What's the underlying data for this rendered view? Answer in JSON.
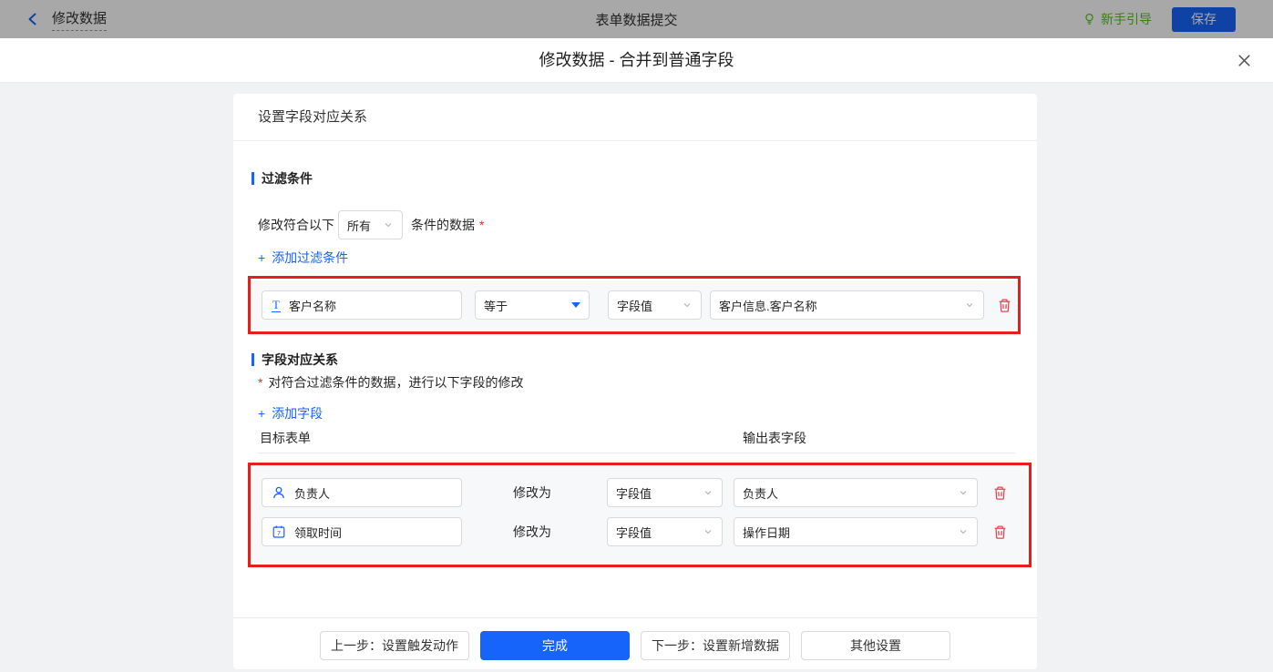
{
  "topbar": {
    "back_label": "修改数据",
    "center_title": "表单数据提交",
    "guide_label": "新手引导",
    "save_label": "保存"
  },
  "modal": {
    "title": "修改数据 - 合并到普通字段"
  },
  "panel": {
    "header_title": "设置字段对应关系",
    "filter": {
      "section_title": "过滤条件",
      "match_prefix": "修改符合以下",
      "match_value": "所有",
      "match_suffix": "条件的数据",
      "required_mark": "*",
      "add_label": "添加过滤条件",
      "row": {
        "field": "客户名称",
        "operator": "等于",
        "value_type": "字段值",
        "value": "客户信息.客户名称"
      }
    },
    "mapping": {
      "section_title": "字段对应关系",
      "required_mark": "*",
      "description": "对符合过滤条件的数据，进行以下字段的修改",
      "add_label": "添加字段",
      "columns": {
        "target": "目标表单",
        "output": "输出表字段"
      },
      "modify_label": "修改为",
      "rows": [
        {
          "field": "负责人",
          "value_type": "字段值",
          "value": "负责人"
        },
        {
          "field": "领取时间",
          "value_type": "字段值",
          "value": "操作日期"
        }
      ]
    },
    "footer": {
      "prev_label": "上一步：设置触发动作",
      "done_label": "完成",
      "next_label": "下一步：设置新增数据",
      "other_label": "其他设置"
    }
  },
  "icons": {
    "text_field_glyph": "T",
    "calendar_digit": "7",
    "plus_glyph": "+"
  },
  "colors": {
    "accent_blue": "#1764fa",
    "guide_green": "#52c41a",
    "annotation_red": "#e81e1e",
    "trash_red": "#f0414e",
    "required_red": "#f5222d",
    "dim_topbar_gray": "#a9a9a9"
  }
}
